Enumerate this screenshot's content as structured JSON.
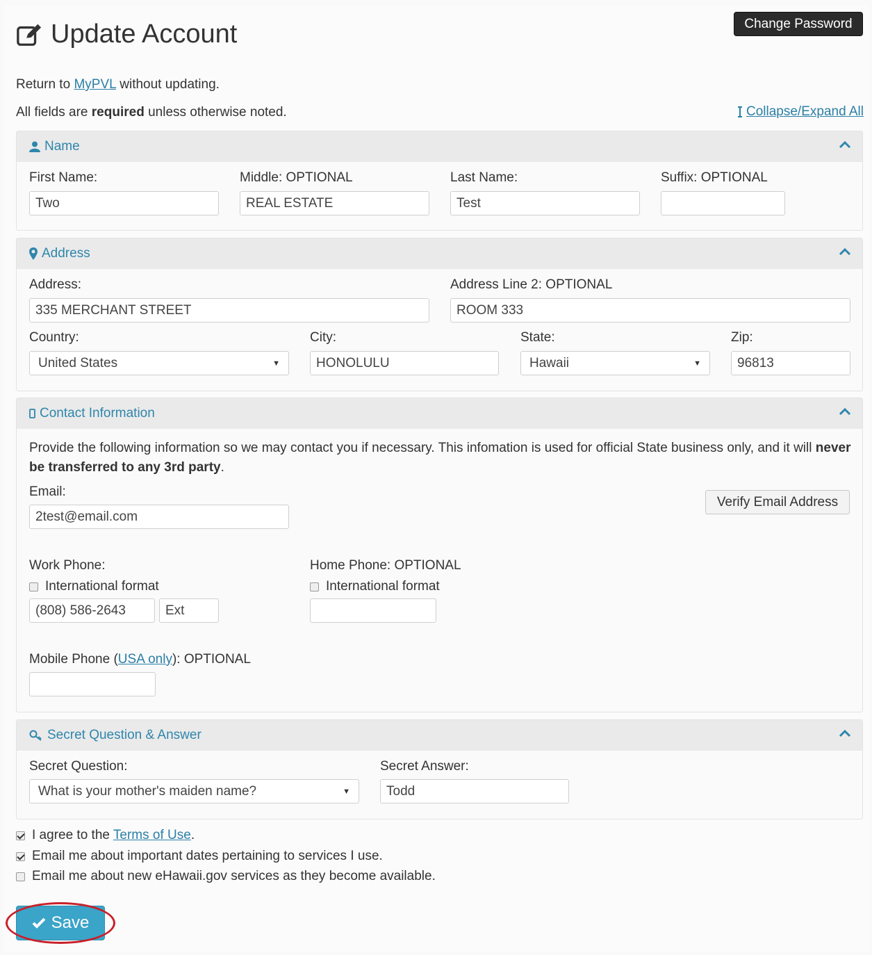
{
  "header": {
    "title": "Update Account",
    "change_password": "Change Password"
  },
  "intro": {
    "return_prefix": "Return to ",
    "return_link": "MyPVL",
    "return_suffix": " without updating.",
    "required_prefix": "All fields are ",
    "required_bold": "required",
    "required_suffix": " unless otherwise noted.",
    "collapse_all": "Collapse/Expand All"
  },
  "name_panel": {
    "title": "Name",
    "first_label": "First Name:",
    "first_value": "Two",
    "middle_label": "Middle: OPTIONAL",
    "middle_value": "REAL ESTATE",
    "last_label": "Last Name:",
    "last_value": "Test",
    "suffix_label": "Suffix: OPTIONAL",
    "suffix_value": ""
  },
  "address_panel": {
    "title": "Address",
    "address_label": "Address:",
    "address_value": "335 MERCHANT STREET",
    "address2_label": "Address Line 2: OPTIONAL",
    "address2_value": "ROOM 333",
    "country_label": "Country:",
    "country_value": "United States",
    "city_label": "City:",
    "city_value": "HONOLULU",
    "state_label": "State:",
    "state_value": "Hawaii",
    "zip_label": "Zip:",
    "zip_value": "96813"
  },
  "contact_panel": {
    "title": "Contact Information",
    "desc_1": "Provide the following information so we may contact you if necessary. This infomation is used for official State business only, and it will",
    "desc_bold": "never be transferred to any 3rd party",
    "desc_end": ".",
    "email_label": "Email:",
    "email_value": "2test@email.com",
    "verify_button": "Verify Email Address",
    "work_label": "Work Phone:",
    "work_intl": "International format",
    "work_value": "(808) 586-2643",
    "work_ext": "Ext",
    "home_label": "Home Phone: OPTIONAL",
    "home_intl": "International format",
    "home_value": "",
    "mobile_prefix": "Mobile Phone (",
    "mobile_link": "USA only",
    "mobile_suffix": "): OPTIONAL",
    "mobile_value": ""
  },
  "secret_panel": {
    "title": "Secret Question & Answer",
    "question_label": "Secret Question:",
    "question_value": "What is your mother's maiden name?",
    "answer_label": "Secret Answer:",
    "answer_value": "Todd"
  },
  "agreements": {
    "terms_prefix": "I agree to the ",
    "terms_link": "Terms of Use",
    "terms_suffix": ".",
    "terms_checked": true,
    "email_dates": "Email me about important dates pertaining to services I use.",
    "email_dates_checked": true,
    "email_services": "Email me about new eHawaii.gov services as they become available.",
    "email_services_checked": false
  },
  "save_button": "Save",
  "colors": {
    "accent": "#2e86ac",
    "save": "#3ba4c9",
    "highlight_ring": "#c9202a"
  }
}
